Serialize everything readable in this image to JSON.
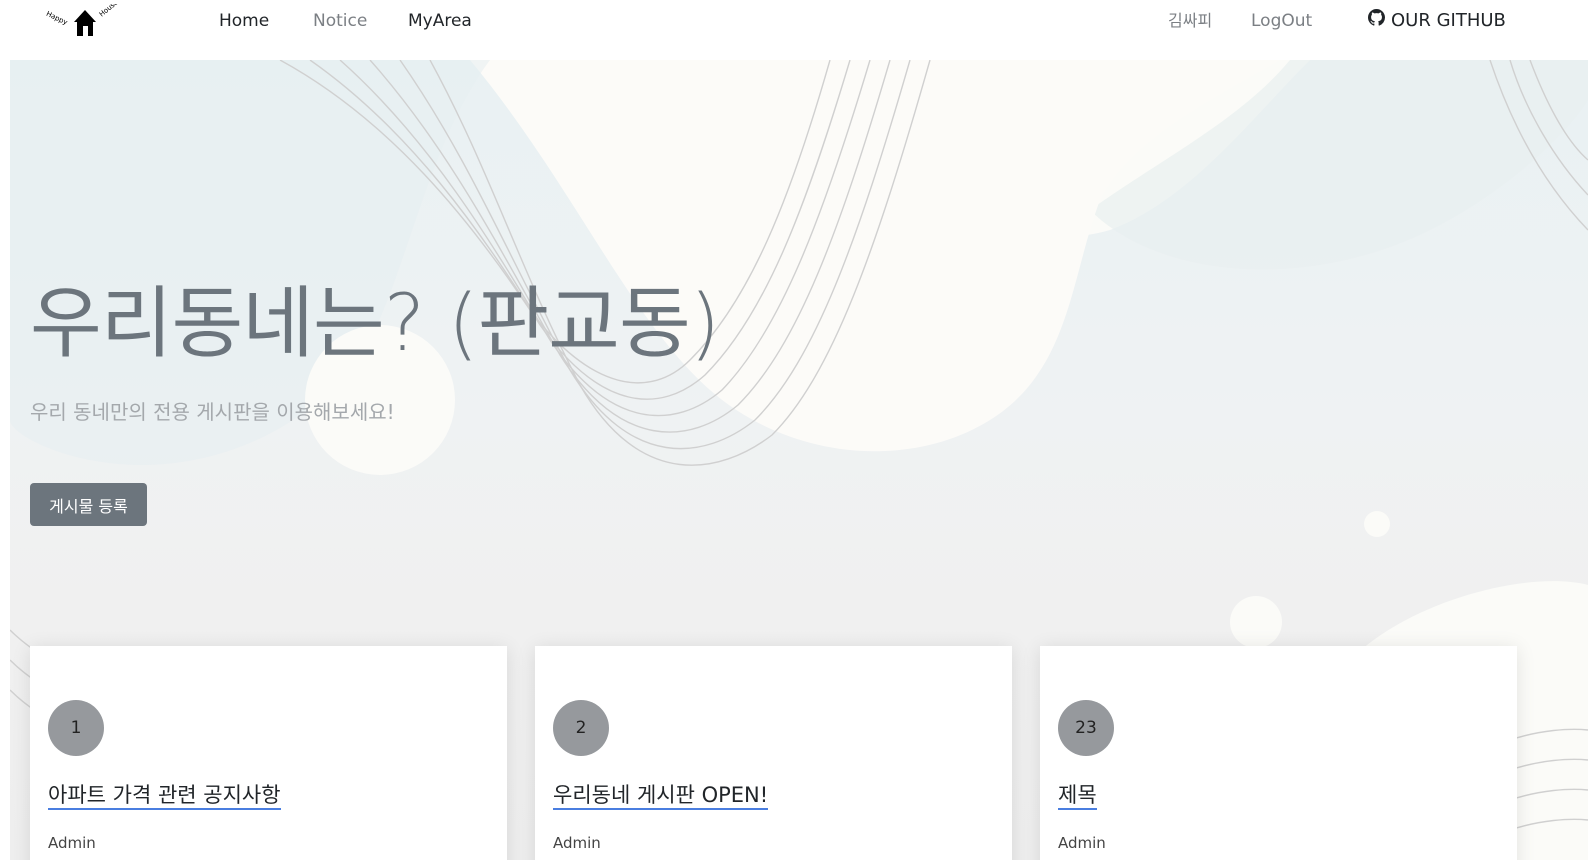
{
  "nav": {
    "logo_text": "Happy House",
    "links": [
      {
        "label": "Home"
      },
      {
        "label": "Notice"
      },
      {
        "label": "MyArea"
      }
    ],
    "user_name": "김싸피",
    "logout_label": "LogOut",
    "github_label": "OUR GITHUB",
    "github_icon": "github-icon"
  },
  "hero": {
    "title": "우리동네는? (판교동)",
    "subtitle": "우리 동네만의 전용 게시판을 이용해보세요!",
    "register_button": "게시물 등록"
  },
  "posts": [
    {
      "number": "1",
      "title": "아파트 가격 관련 공지사항",
      "author": "Admin"
    },
    {
      "number": "2",
      "title": "우리동네 게시판 OPEN!",
      "author": "Admin"
    },
    {
      "number": "23",
      "title": "제목",
      "author": "Admin"
    }
  ],
  "colors": {
    "button_bg": "#6c757d",
    "title_underline": "#4a7ee0",
    "badge_bg": "#96999d"
  }
}
